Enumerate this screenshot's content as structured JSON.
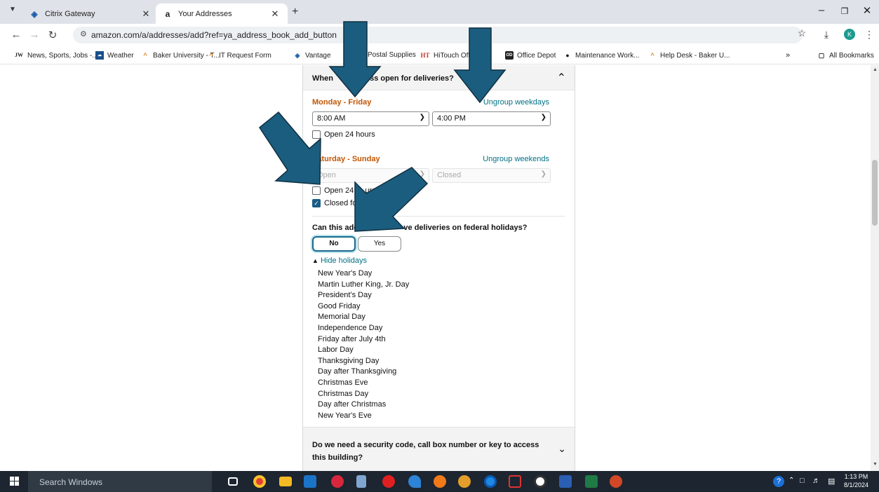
{
  "tabs": [
    {
      "title": "Citrix Gateway",
      "icon": "citrix-icon"
    },
    {
      "title": "Your Addresses",
      "icon": "amazon-icon"
    }
  ],
  "url": "amazon.com/a/addresses/add?ref=ya_address_book_add_button",
  "avatar_initial": "K",
  "bookmarks": [
    "News, Sports, Jobs -...",
    "Weather",
    "Baker University - T...",
    "IT Request Form",
    "Vantage",
    "Postal Supplies",
    "HiTouch Off",
    "Office Depot",
    "Maintenance Work...",
    "Help Desk - Baker U..."
  ],
  "bookmarks_overflow": "»",
  "all_bookmarks": "All Bookmarks",
  "delivery": {
    "question_left": "When",
    "question_right": "ess open for deliveries?",
    "weekdays": {
      "label": "Monday - Friday",
      "ungroup": "Ungroup weekdays",
      "open_time": "8:00 AM",
      "close_time": "4:00 PM",
      "open24": "Open 24 hours",
      "open24_checked": false
    },
    "weekends": {
      "label": "Saturday - Sunday",
      "ungroup": "Ungroup weekends",
      "open_time": "Open",
      "close_time": "Closed",
      "open24_part1": "Open 24 h",
      "open24_part2": "urs",
      "closed_for": "Closed for",
      "closed_checked": true
    }
  },
  "holidays": {
    "question_a": "Can this addre",
    "question_b": "ve deliveries on federal holidays?",
    "no": "No",
    "yes": "Yes",
    "selected": "No",
    "hide_link": "Hide holidays",
    "list": [
      "New Year's Day",
      "Martin Luther King, Jr. Day",
      "President's Day",
      "Good Friday",
      "Memorial Day",
      "Independence Day",
      "Friday after July 4th",
      "Labor Day",
      "Thanksgiving Day",
      "Day after Thanksgiving",
      "Christmas Eve",
      "Christmas Day",
      "Day after Christmas",
      "New Year's Eve"
    ]
  },
  "security": {
    "question": "Do we need a security code, call box number or key to access this building?"
  },
  "taskbar": {
    "search_placeholder": "Search Windows",
    "time": "1:13 PM",
    "date": "8/1/2024"
  },
  "colors": {
    "accent_orange": "#c45500",
    "link_teal": "#007185",
    "annotation_arrow": "#1b5d7e",
    "taskbar": "#1c2530"
  }
}
